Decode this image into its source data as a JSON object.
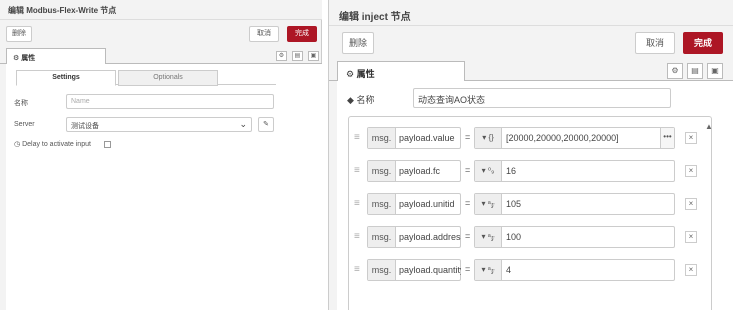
{
  "left": {
    "title": "编辑 Modbus-Flex-Write 节点",
    "delete_label": "删除",
    "cancel_label": "取消",
    "done_label": "完成",
    "tab_label": "⚙ 属性",
    "subtabs": [
      "Settings",
      "Optionals"
    ],
    "name_label": "名称",
    "name_placeholder": "Name",
    "server_label": "Server",
    "server_value": "测试设备",
    "delay_label": "Delay to activate input"
  },
  "right": {
    "title": "编辑 inject 节点",
    "delete_label": "删除",
    "cancel_label": "取消",
    "done_label": "完成",
    "tab_label": "⚙ 属性",
    "name_label": "名称",
    "name_value": "动态查询AO状态",
    "props": [
      {
        "prefix": "msg.",
        "prop": "payload.value",
        "type": "{}",
        "value": "[20000,20000,20000,20000]",
        "has_more": true
      },
      {
        "prefix": "msg.",
        "prop": "payload.fc",
        "type": "⁰₉",
        "value": "16",
        "has_more": false
      },
      {
        "prefix": "msg.",
        "prop": "payload.unitid",
        "type": "ᵃ𝓏",
        "value": "105",
        "has_more": false
      },
      {
        "prefix": "msg.",
        "prop": "payload.address",
        "type": "ᵃ𝓏",
        "value": "100",
        "has_more": false
      },
      {
        "prefix": "msg.",
        "prop": "payload.quantity",
        "type": "ᵃ𝓏",
        "value": "4",
        "has_more": false
      }
    ]
  },
  "colors": {
    "primary": "#ad1625"
  }
}
